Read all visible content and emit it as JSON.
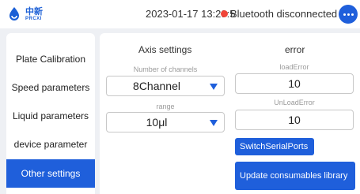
{
  "header": {
    "logo_cn": "中新",
    "logo_en": "PRCXI",
    "datetime": "2023-01-17 13:29:5",
    "bluetooth_status": "Bluetooth disconnected",
    "status_color": "#f04438",
    "more_icon": "more-horizontal-icon"
  },
  "sidebar": {
    "items": [
      {
        "label": "Plate Calibration",
        "active": false
      },
      {
        "label": "Speed parameters",
        "active": false
      },
      {
        "label": "Liquid parameters",
        "active": false
      },
      {
        "label": "device parameter",
        "active": false
      },
      {
        "label": "Other settings",
        "active": true
      }
    ]
  },
  "axis_settings": {
    "title": "Axis settings",
    "channels_label": "Number of channels",
    "channels_value": "8Channel",
    "range_label": "range",
    "range_value": "10μl"
  },
  "error": {
    "title": "error",
    "load_label": "loadError",
    "load_value": "10",
    "unload_label": "UnLoadError",
    "unload_value": "10"
  },
  "buttons": {
    "switch_serial": "SwitchSerialPorts",
    "update_library": "Update consumables library"
  },
  "colors": {
    "accent": "#1f5fdb",
    "background": "#eef0f4"
  }
}
